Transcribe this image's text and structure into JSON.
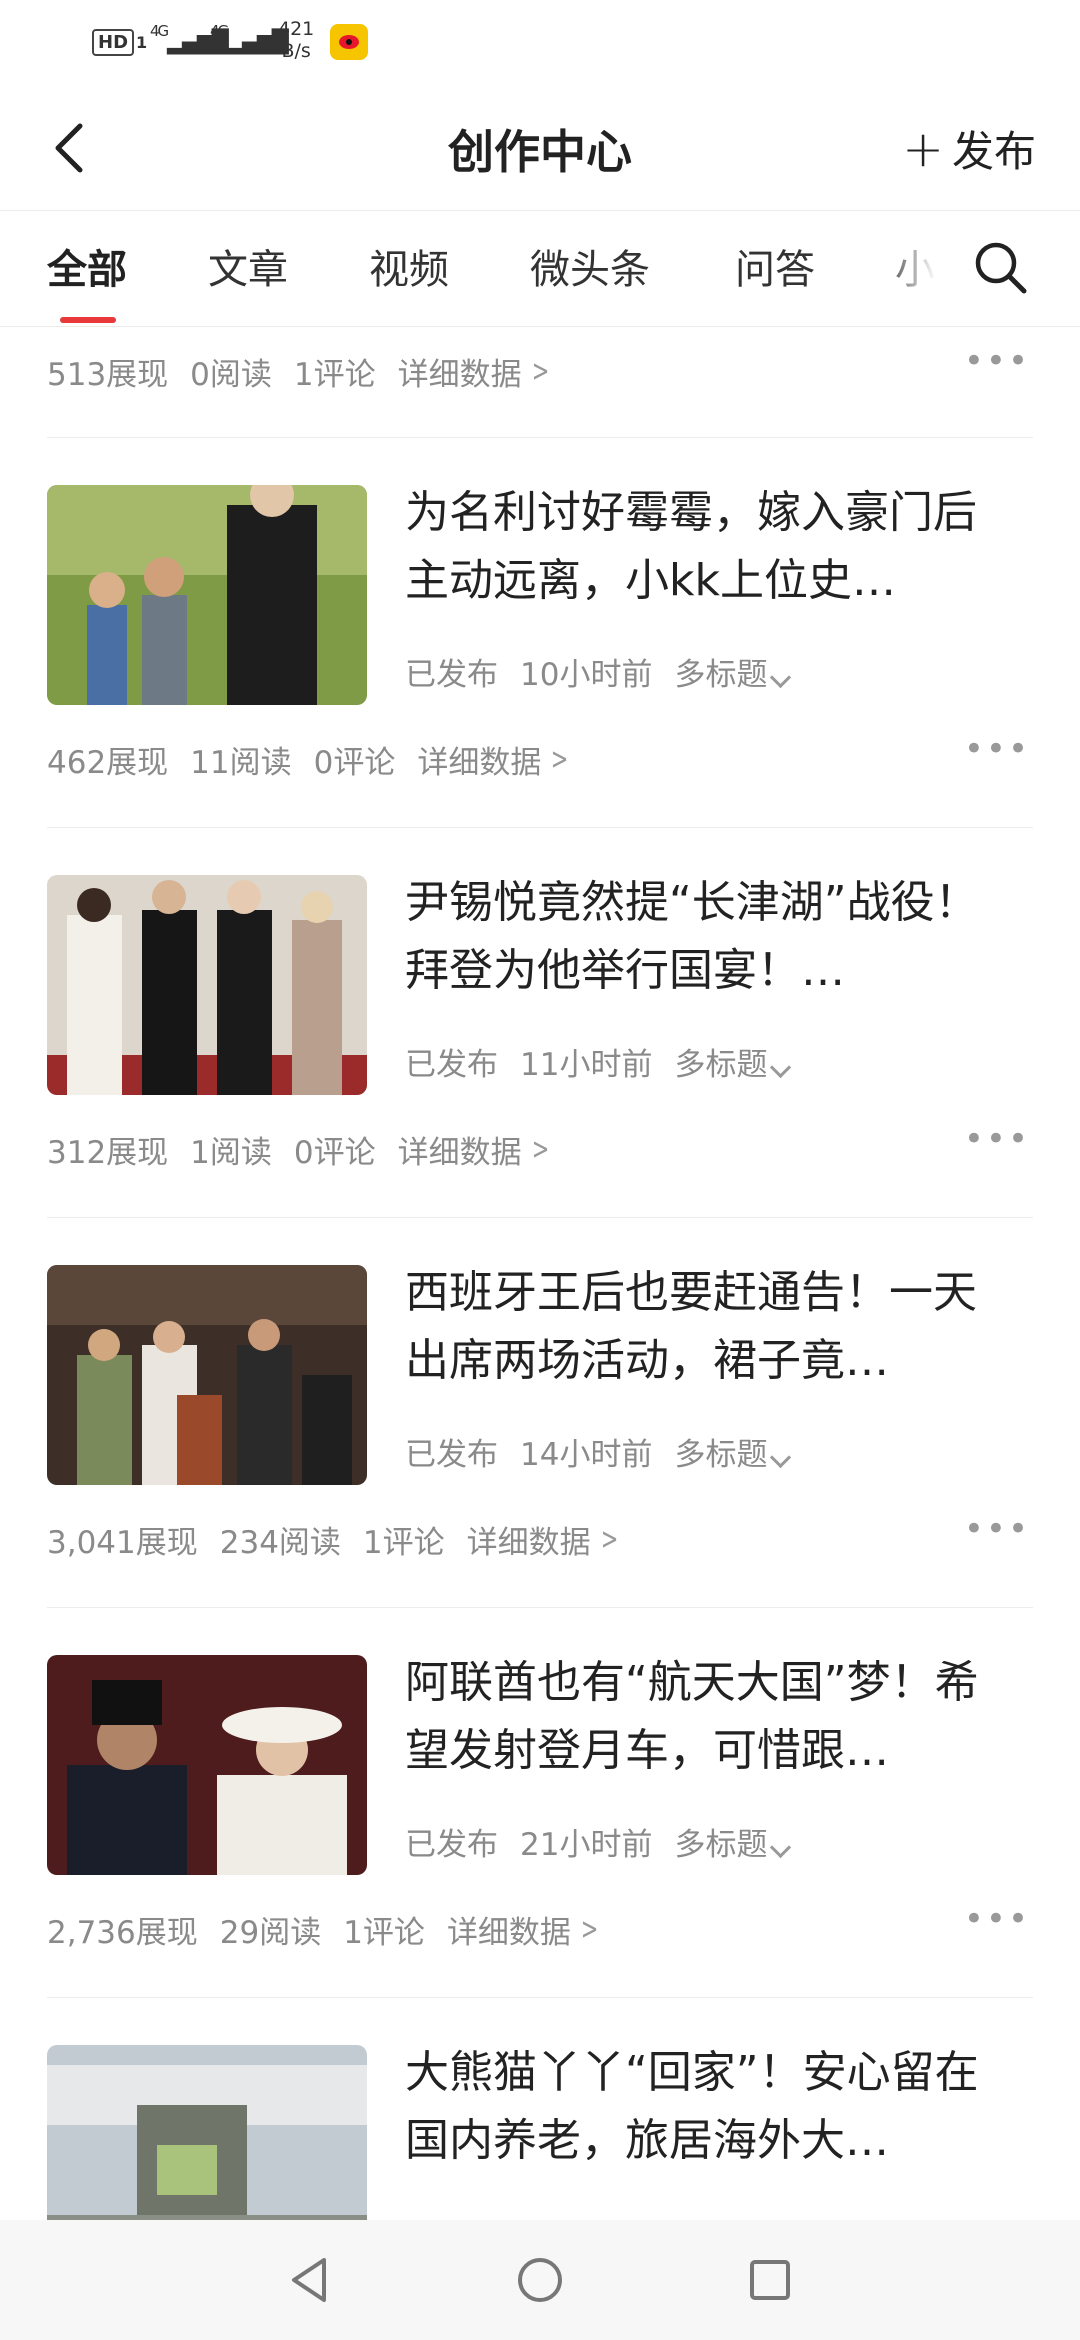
{
  "status_bar": {
    "hd": "HD",
    "sim": "1",
    "net1": "4G",
    "net2": "4G",
    "rate_value": "421",
    "rate_unit": "B/s",
    "app_icon": "weibo-icon"
  },
  "header": {
    "title": "创作中心",
    "back_icon": "back-arrow-icon",
    "publish_label": "发布",
    "publish_icon": "plus-icon"
  },
  "tabs": [
    {
      "label": "全部",
      "active": true
    },
    {
      "label": "文章",
      "active": false
    },
    {
      "label": "视频",
      "active": false
    },
    {
      "label": "微头条",
      "active": false
    },
    {
      "label": "问答",
      "active": false
    },
    {
      "label": "小",
      "active": false
    }
  ],
  "search_icon": "search-icon",
  "top_stats": {
    "views": "513展现",
    "reads": "0阅读",
    "comments": "1评论",
    "detail": "详细数据"
  },
  "articles": [
    {
      "title": "为名利讨好霉霉，嫁入豪门后主动远离，小kk上位史…",
      "status": "已发布",
      "time": "10小时前",
      "tag": "多标题",
      "stats": {
        "views": "462展现",
        "reads": "11阅读",
        "comments": "0评论",
        "detail": "详细数据"
      },
      "thumb_colors": [
        "#6f8f3a",
        "#c9b48a"
      ]
    },
    {
      "title": "尹锡悦竟然提“长津湖”战役！拜登为他举行国宴！…",
      "status": "已发布",
      "time": "11小时前",
      "tag": "多标题",
      "stats": {
        "views": "312展现",
        "reads": "1阅读",
        "comments": "0评论",
        "detail": "详细数据"
      },
      "thumb_colors": [
        "#d9d2c8",
        "#1c1c1c"
      ]
    },
    {
      "title": "西班牙王后也要赶通告！一天出席两场活动，裙子竟…",
      "status": "已发布",
      "time": "14小时前",
      "tag": "多标题",
      "stats": {
        "views": "3,041展现",
        "reads": "234阅读",
        "comments": "1评论",
        "detail": "详细数据"
      },
      "thumb_colors": [
        "#4a3a2e",
        "#8a5a3a"
      ]
    },
    {
      "title": "阿联酋也有“航天大国”梦！希望发射登月车，可惜跟…",
      "status": "已发布",
      "time": "21小时前",
      "tag": "多标题",
      "stats": {
        "views": "2,736展现",
        "reads": "29阅读",
        "comments": "1评论",
        "detail": "详细数据"
      },
      "thumb_colors": [
        "#5a2020",
        "#e8e2d6"
      ]
    },
    {
      "title": "大熊猫丫丫“回家”！安心留在国内养老，旅居海外大…",
      "thumb_colors": [
        "#b7c0c6",
        "#7a7f70"
      ]
    }
  ],
  "more_icon": "more-dots-icon",
  "navbar": {
    "back": "nav-back-icon",
    "home": "nav-home-icon",
    "recents": "nav-recents-icon"
  }
}
